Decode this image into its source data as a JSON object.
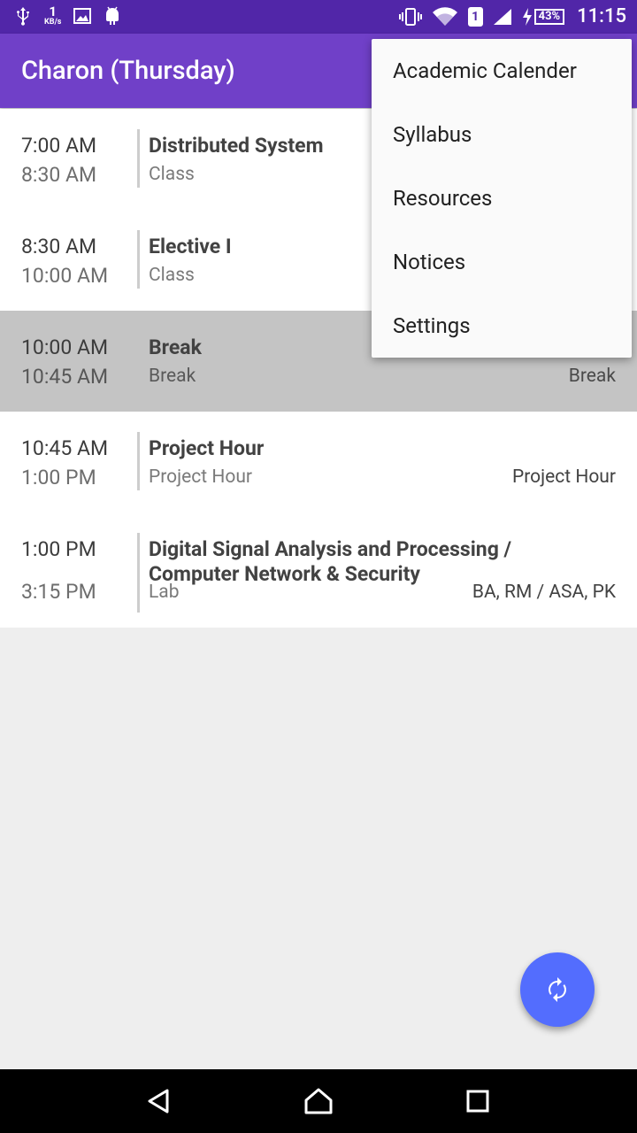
{
  "status_bar": {
    "speed_value": "1",
    "speed_unit": "KB/s",
    "sim_number": "1",
    "battery": "43%",
    "time": "11:15"
  },
  "app_bar": {
    "title": "Charon (Thursday)"
  },
  "schedule": [
    {
      "start": "7:00 AM",
      "end": "8:30 AM",
      "subject": "Distributed System",
      "type": "Class",
      "teacher": ""
    },
    {
      "start": "8:30 AM",
      "end": "10:00 AM",
      "subject": "Elective I",
      "type": "Class",
      "teacher": ""
    },
    {
      "start": "10:00 AM",
      "end": "10:45 AM",
      "subject": "Break",
      "type": "Break",
      "teacher": "Break"
    },
    {
      "start": "10:45 AM",
      "end": "1:00 PM",
      "subject": "Project Hour",
      "type": "Project Hour",
      "teacher": "Project Hour"
    },
    {
      "start": "1:00 PM",
      "end": "3:15 PM",
      "subject": "Digital Signal Analysis and Processing / Computer Network & Security",
      "type": "Lab",
      "teacher": "BA, RM / ASA, PK"
    }
  ],
  "menu": {
    "items": [
      "Academic Calender",
      "Syllabus",
      "Resources",
      "Notices",
      "Settings"
    ]
  },
  "fab": {
    "icon": "refresh-icon"
  },
  "nav": {
    "icons": [
      "back-icon",
      "home-icon",
      "recents-icon"
    ]
  }
}
